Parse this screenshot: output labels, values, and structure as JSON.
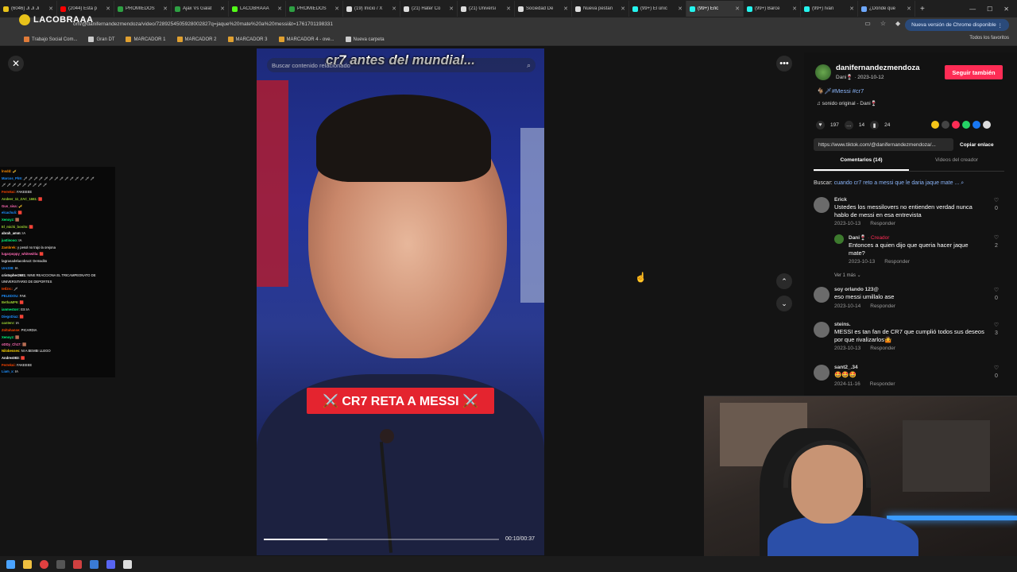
{
  "browser": {
    "tabs": [
      {
        "label": "(6046) Ji Ji Ji",
        "color": "#e8c21a",
        "active": false
      },
      {
        "label": "(2044) Esta p",
        "color": "#ff0000",
        "active": false
      },
      {
        "label": "PROMIEDOS",
        "color": "#2ea043",
        "active": false
      },
      {
        "label": "Ajax Vs Galat",
        "color": "#2ea043",
        "active": false
      },
      {
        "label": "LACOBRAAA",
        "color": "#53fc18",
        "active": false
      },
      {
        "label": "PROMIEDOS",
        "color": "#2ea043",
        "active": false
      },
      {
        "label": "(19) Inicio / X",
        "color": "#dddddd",
        "active": false
      },
      {
        "label": "(21) Hater Co",
        "color": "#dddddd",
        "active": false
      },
      {
        "label": "(21) Universi",
        "color": "#dddddd",
        "active": false
      },
      {
        "label": "Sociedad De",
        "color": "#dddddd",
        "active": false
      },
      {
        "label": "Nueva pestañ",
        "color": "#dddddd",
        "active": false
      },
      {
        "label": "(99+) El únic",
        "color": "#25f4ee",
        "active": false
      },
      {
        "label": "(99+) Enc",
        "color": "#25f4ee",
        "active": true
      },
      {
        "label": "(99+) Barce",
        "color": "#25f4ee",
        "active": false
      },
      {
        "label": "(99+) Ivan",
        "color": "#25f4ee",
        "active": false
      },
      {
        "label": "¿Dónde que",
        "color": "#6ea8fe",
        "active": false
      }
    ],
    "new_tab": "+",
    "overlay_logo": "LACOBRAAA",
    "url": "om/@danifernandezmendoza/video/7289254505928002827q=jaque%20mate%20a%20messi&t=1761701198331",
    "update_label": "Nueva versión de Chrome disponible",
    "bookmarks": [
      {
        "label": "Trabajo Social Com...",
        "color": "#e07b39"
      },
      {
        "label": "Gran DT",
        "color": "#cccccc"
      },
      {
        "label": "MARCADOR 1",
        "color": "#e0a030"
      },
      {
        "label": "MARCADOR 2",
        "color": "#e0a030"
      },
      {
        "label": "MARCADOR 3",
        "color": "#e0a030"
      },
      {
        "label": "MARCADOR 4 - ove...",
        "color": "#e0a030"
      },
      {
        "label": "Nueva carpeta",
        "color": "#cccccc"
      }
    ],
    "all_bookmarks": "Todos los favoritos"
  },
  "video": {
    "title": "cr7 antes del mundial...",
    "search_placeholder": "Buscar contenido relacionado",
    "caption": "⚔️ CR7 RETA A MESSI ⚔️",
    "progress": 0.27,
    "time": "00:10/00:37"
  },
  "chat": [
    {
      "user": "lnsdd",
      "color": "#ff8c00",
      "msg": "🎺"
    },
    {
      "user": "Marcos_Ph9",
      "color": "#1e90ff",
      "msg": "🗡 🗡 🗡 🗡 🗡 🗡 🗡 🗡 🗡 🗡 🗡 🗡 🗡 🗡"
    },
    {
      "user": "",
      "color": "#ffffff",
      "msg": "🗡 🗡 🗡 🗡 🗡 🗡 🗡 🗡 🗡"
    },
    {
      "user": "Ferrekoi",
      "color": "#ff4500",
      "msg": "FAKEEEE"
    },
    {
      "user": "Andeer_11_ZAC_1661",
      "color": "#9acd32",
      "msg": "🟥"
    },
    {
      "user": "Gus_sisa",
      "color": "#ff69b4",
      "msg": "🎺"
    },
    {
      "user": "elcachuli",
      "color": "#1e90ff",
      "msg": "🟥"
    },
    {
      "user": "Xenoyz",
      "color": "#00ff7f",
      "msg": "🟫"
    },
    {
      "user": "El_michi_bonito",
      "color": "#9acd32",
      "msg": "🟥"
    },
    {
      "user": "abrah_amm",
      "color": "#ffffff",
      "msg": "IA"
    },
    {
      "user": "justinooo",
      "color": "#00ff7f",
      "msg": "IA"
    },
    {
      "user": "Zambrek",
      "color": "#ff8c00",
      "msg": "y pesol no trajo la orejona"
    },
    {
      "user": "lugarpoppy_whitewitla",
      "color": "#ff69b4",
      "msg": "🟥"
    },
    {
      "user": "lagrasadelacobra3",
      "color": "#cccccc",
      "msg": "Demadito"
    },
    {
      "user": "Uro338",
      "color": "#1e90ff",
      "msg": "IA"
    },
    {
      "user": "cristopher2681",
      "color": "#ffffff",
      "msg": "NINE REACCIONA EL TRICAMPEONATO DE"
    },
    {
      "user": "",
      "color": "#ffffff",
      "msg": "UNIVERSITARIO DE DEPORTES"
    },
    {
      "user": "tetl2rc",
      "color": "#ff4500",
      "msg": "🗡"
    },
    {
      "user": "PELEDOU",
      "color": "#1e90ff",
      "msg": "FAK"
    },
    {
      "user": "BethaMP9",
      "color": "#9acd32",
      "msg": "🟥"
    },
    {
      "user": "ianmestorr",
      "color": "#00ff7f",
      "msg": "ES IA"
    },
    {
      "user": "DiegoDiaz",
      "color": "#1e90ff",
      "msg": "🟥"
    },
    {
      "user": "oantenr",
      "color": "#9acd32",
      "msg": "IA"
    },
    {
      "user": "Zoltahanse",
      "color": "#ff4500",
      "msg": "PICARDIA"
    },
    {
      "user": "Xenoyz",
      "color": "#00ff7f",
      "msg": "🟫"
    },
    {
      "user": "oDDy_Ch17",
      "color": "#ff69b4",
      "msg": "🟫"
    },
    {
      "user": "Nilobesses",
      "color": "#ffd700",
      "msg": "NI A BEMBI LLEGO"
    },
    {
      "user": "Andres083",
      "color": "#ffffff",
      "msg": "🟥"
    },
    {
      "user": "Ferrekoi",
      "color": "#ff4500",
      "msg": "FAKEEEE"
    },
    {
      "user": "Liam_x",
      "color": "#1e90ff",
      "msg": "IA"
    }
  ],
  "panel": {
    "creator_name": "danifernandezmendoza",
    "creator_meta": "Dani🍷 · 2023-10-12",
    "follow_label": "Seguir también",
    "description": "🐐🗡#Messi #cr7",
    "sound": "♫  sonido original - Dani🍷",
    "likes": "197",
    "comments": "14",
    "saves": "24",
    "share_colors": [
      "#f5c518",
      "#444444",
      "#fe2c55",
      "#25d366",
      "#1877f2",
      "#dddddd"
    ],
    "link": "https://www.tiktok.com/@danifernandezmendoza/...",
    "copy_label": "Copiar enlace",
    "tab_comments": "Comentarios (14)",
    "tab_videos": "Videos del creador",
    "search_prefix": "Buscar:",
    "search_query": "cuando cr7 reto a messi que le daria jaque mate ...",
    "comments_list": [
      {
        "author": "Erick",
        "tag": "",
        "text": "Ustedes los messilovers no entienden verdad nunca hablo de messi en esa entrevista",
        "date": "2023-10-13",
        "reply": "Responder",
        "likes": "0",
        "is_reply": false
      },
      {
        "author": "Dani🍷",
        "tag": " · Creador",
        "text": "Entonces a quien dijo que queria hacer jaque mate?",
        "date": "2023-10-13",
        "reply": "Responder",
        "likes": "2",
        "is_reply": true
      },
      {
        "author": "soy orlando 123@",
        "tag": "",
        "text": "eso messi umillalo ase",
        "date": "2023-10-14",
        "reply": "Responder",
        "likes": "0",
        "is_reply": false
      },
      {
        "author": "steins.",
        "tag": "",
        "text": "MESSI es tan fan de CR7 que cumplió todos sus deseos por que rivalizarlos🤷",
        "date": "2023-10-13",
        "reply": "Responder",
        "likes": "3",
        "is_reply": false
      },
      {
        "author": "sant2_.34",
        "tag": "",
        "text": "🤩🤩🤩",
        "date": "2024-11-16",
        "reply": "Responder",
        "likes": "0",
        "is_reply": false
      }
    ],
    "more_replies": "Ver 1 más ⌄"
  },
  "controls": {
    "close_icon": "✕",
    "more_icon": "•••",
    "up_icon": "⌃",
    "down_icon": "⌄"
  }
}
